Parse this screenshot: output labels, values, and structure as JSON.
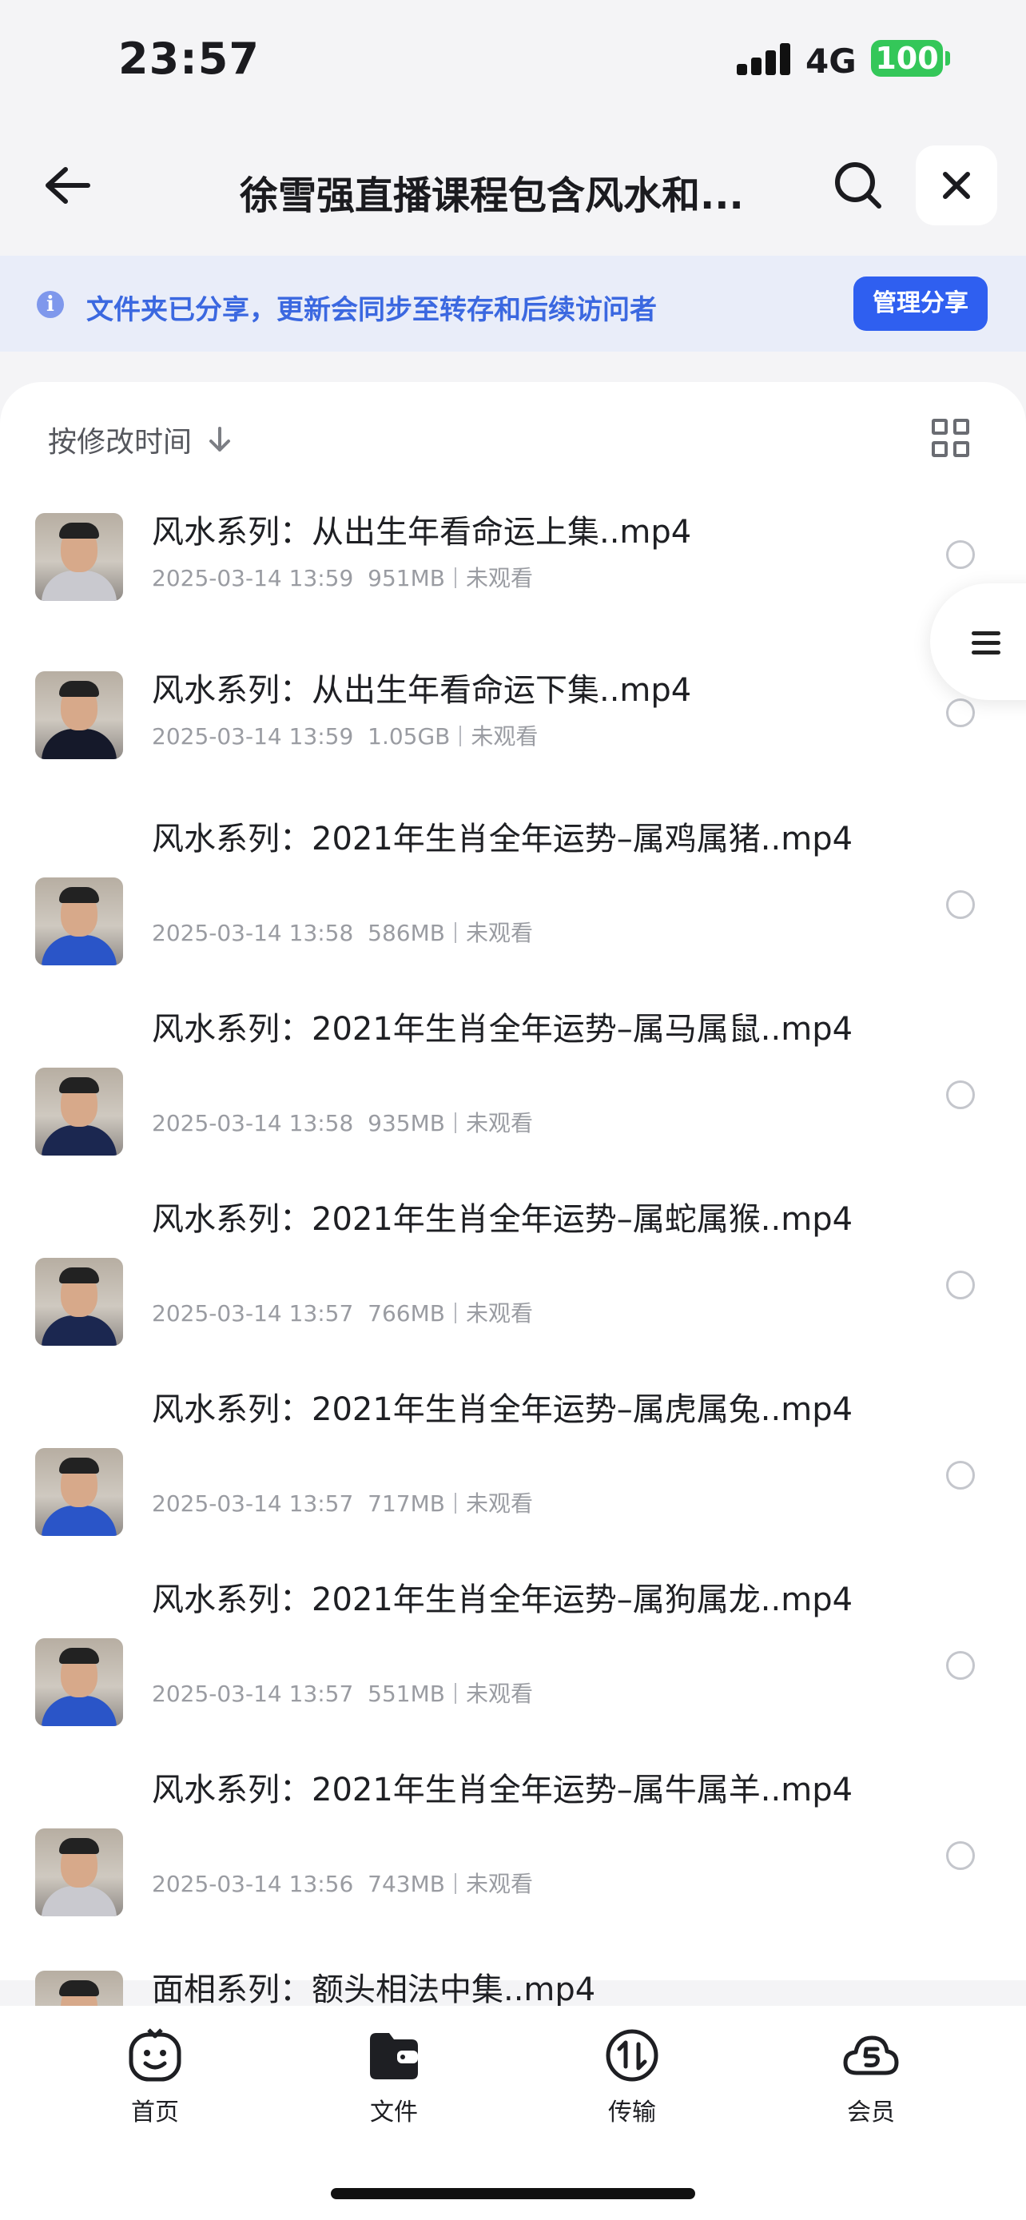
{
  "status_bar": {
    "time": "23:57",
    "network": "4G",
    "battery": "100"
  },
  "nav": {
    "title": "徐雪强直播课程包含风水和..."
  },
  "banner": {
    "text": "文件夹已分享，更新会同步至转存和后续访问者",
    "manage_label": "管理分享"
  },
  "sort": {
    "label": "按修改时间"
  },
  "files": [
    {
      "name": "风水系列：从出生年看命运上集..mp4",
      "date": "2025-03-14 13:59",
      "size": "951MB",
      "status": "未观看",
      "shirt": "#c9c9cf"
    },
    {
      "name": "风水系列：从出生年看命运下集..mp4",
      "date": "2025-03-14 13:59",
      "size": "1.05GB",
      "status": "未观看",
      "shirt": "#15192a"
    },
    {
      "name": "风水系列：2021年生肖全年运势–属鸡属猪..mp4",
      "date": "2025-03-14 13:58",
      "size": "586MB",
      "status": "未观看",
      "shirt": "#2a55c8"
    },
    {
      "name": "风水系列：2021年生肖全年运势–属马属鼠..mp4",
      "date": "2025-03-14 13:58",
      "size": "935MB",
      "status": "未观看",
      "shirt": "#1b2750"
    },
    {
      "name": "风水系列：2021年生肖全年运势–属蛇属猴..mp4",
      "date": "2025-03-14 13:57",
      "size": "766MB",
      "status": "未观看",
      "shirt": "#1b2750"
    },
    {
      "name": "风水系列：2021年生肖全年运势–属虎属兔..mp4",
      "date": "2025-03-14 13:57",
      "size": "717MB",
      "status": "未观看",
      "shirt": "#2a55c8"
    },
    {
      "name": "风水系列：2021年生肖全年运势–属狗属龙..mp4",
      "date": "2025-03-14 13:57",
      "size": "551MB",
      "status": "未观看",
      "shirt": "#2a55c8"
    },
    {
      "name": "风水系列：2021年生肖全年运势–属牛属羊..mp4",
      "date": "2025-03-14 13:56",
      "size": "743MB",
      "status": "未观看",
      "shirt": "#c9c9cf"
    },
    {
      "name": "面相系列：额头相法中集..mp4",
      "date": "",
      "size": "",
      "status": "",
      "shirt": "#c9c9cf"
    }
  ],
  "tabs": [
    {
      "label": "首页",
      "icon": "smiley-icon"
    },
    {
      "label": "文件",
      "icon": "folder-icon"
    },
    {
      "label": "传输",
      "icon": "transfer-icon"
    },
    {
      "label": "会员",
      "icon": "vip-cloud-icon"
    }
  ],
  "colors": {
    "accent": "#2f5ff0",
    "banner_bg": "#e9edf9",
    "banner_text": "#3b68e0",
    "battery": "#34c759"
  }
}
